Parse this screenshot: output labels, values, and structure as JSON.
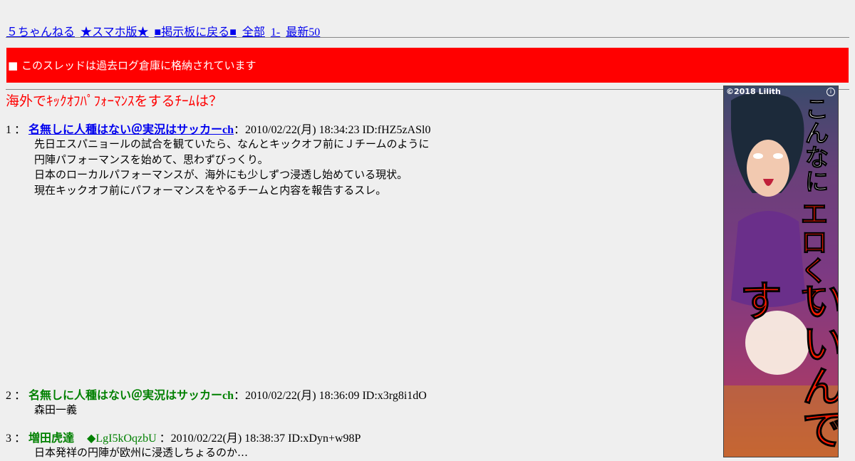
{
  "nav": {
    "links": [
      "５ちゃんねる",
      "★スマホ版★",
      "■掲示板に戻る■",
      "全部",
      "1-",
      "最新50"
    ]
  },
  "notice": "■ このスレッドは過去ログ倉庫に格納されています",
  "thread_title": "海外でｷｯｸｵﾌﾊﾟﾌｫｰﾏﾝｽをするﾁｰﾑは？",
  "posts": [
    {
      "num": "1",
      "name": "名無しに人種はない＠実況はサッカーch",
      "trip": "",
      "meta": "：2010/02/22(月) 18:34:23 ID:fHZ5zASl0",
      "lines": [
        "先日エスパニョールの試合を観ていたら、なんとキックオフ前にＪチームのように",
        "円陣パフォーマンスを始めて、思わずびっくり。",
        "日本のローカルパフォーマンスが、海外にも少しずつ浸透し始めている現状。",
        "現在キックオフ前にパフォーマンスをやるチームと内容を報告するスレ。"
      ]
    },
    {
      "num": "2",
      "name": "名無しに人種はない＠実況はサッカーch",
      "trip": "",
      "meta": "：2010/02/22(月) 18:36:09 ID:x3rg8i1dO",
      "lines": [
        "森田一義"
      ]
    },
    {
      "num": "3",
      "name": "増田虎達",
      "trip": "◆LgI5kOqzbU",
      "meta": "：2010/02/22(月) 18:38:37 ID:xDyn+w98P",
      "lines": [
        "日本発祥の円陣が欧州に浸透しちょるのか…"
      ]
    }
  ],
  "ad": {
    "copyright": "©2018 Lilith",
    "text1": "こんなに",
    "text2": "エロくて",
    "text3": "いいんです"
  },
  "colors": {
    "background": "#efefef",
    "notice_bg": "#ff0000",
    "title": "#ff0000",
    "link": "#0000ee",
    "name_green": "#008000"
  }
}
